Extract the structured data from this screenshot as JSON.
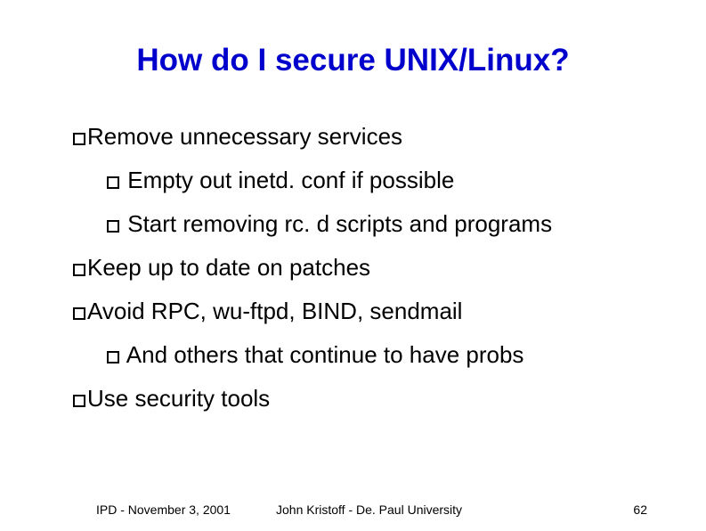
{
  "title": "How do I secure UNIX/Linux?",
  "bullets": [
    {
      "text": "Remove unnecessary services",
      "level": 0
    },
    {
      "text": "Empty out inetd. conf if possible",
      "level": 1
    },
    {
      "text": "Start removing rc. d scripts and programs",
      "level": 1
    },
    {
      "text": "Keep up to date on patches",
      "level": 0
    },
    {
      "text": "Avoid RPC, wu-ftpd, BIND, sendmail",
      "level": 0
    },
    {
      "text": "And others that continue to have probs",
      "level": 1
    },
    {
      "text": "Use security tools",
      "level": 0
    }
  ],
  "footer": {
    "left": "IPD - November 3, 2001",
    "center": "John Kristoff - De. Paul University",
    "right": "62"
  }
}
